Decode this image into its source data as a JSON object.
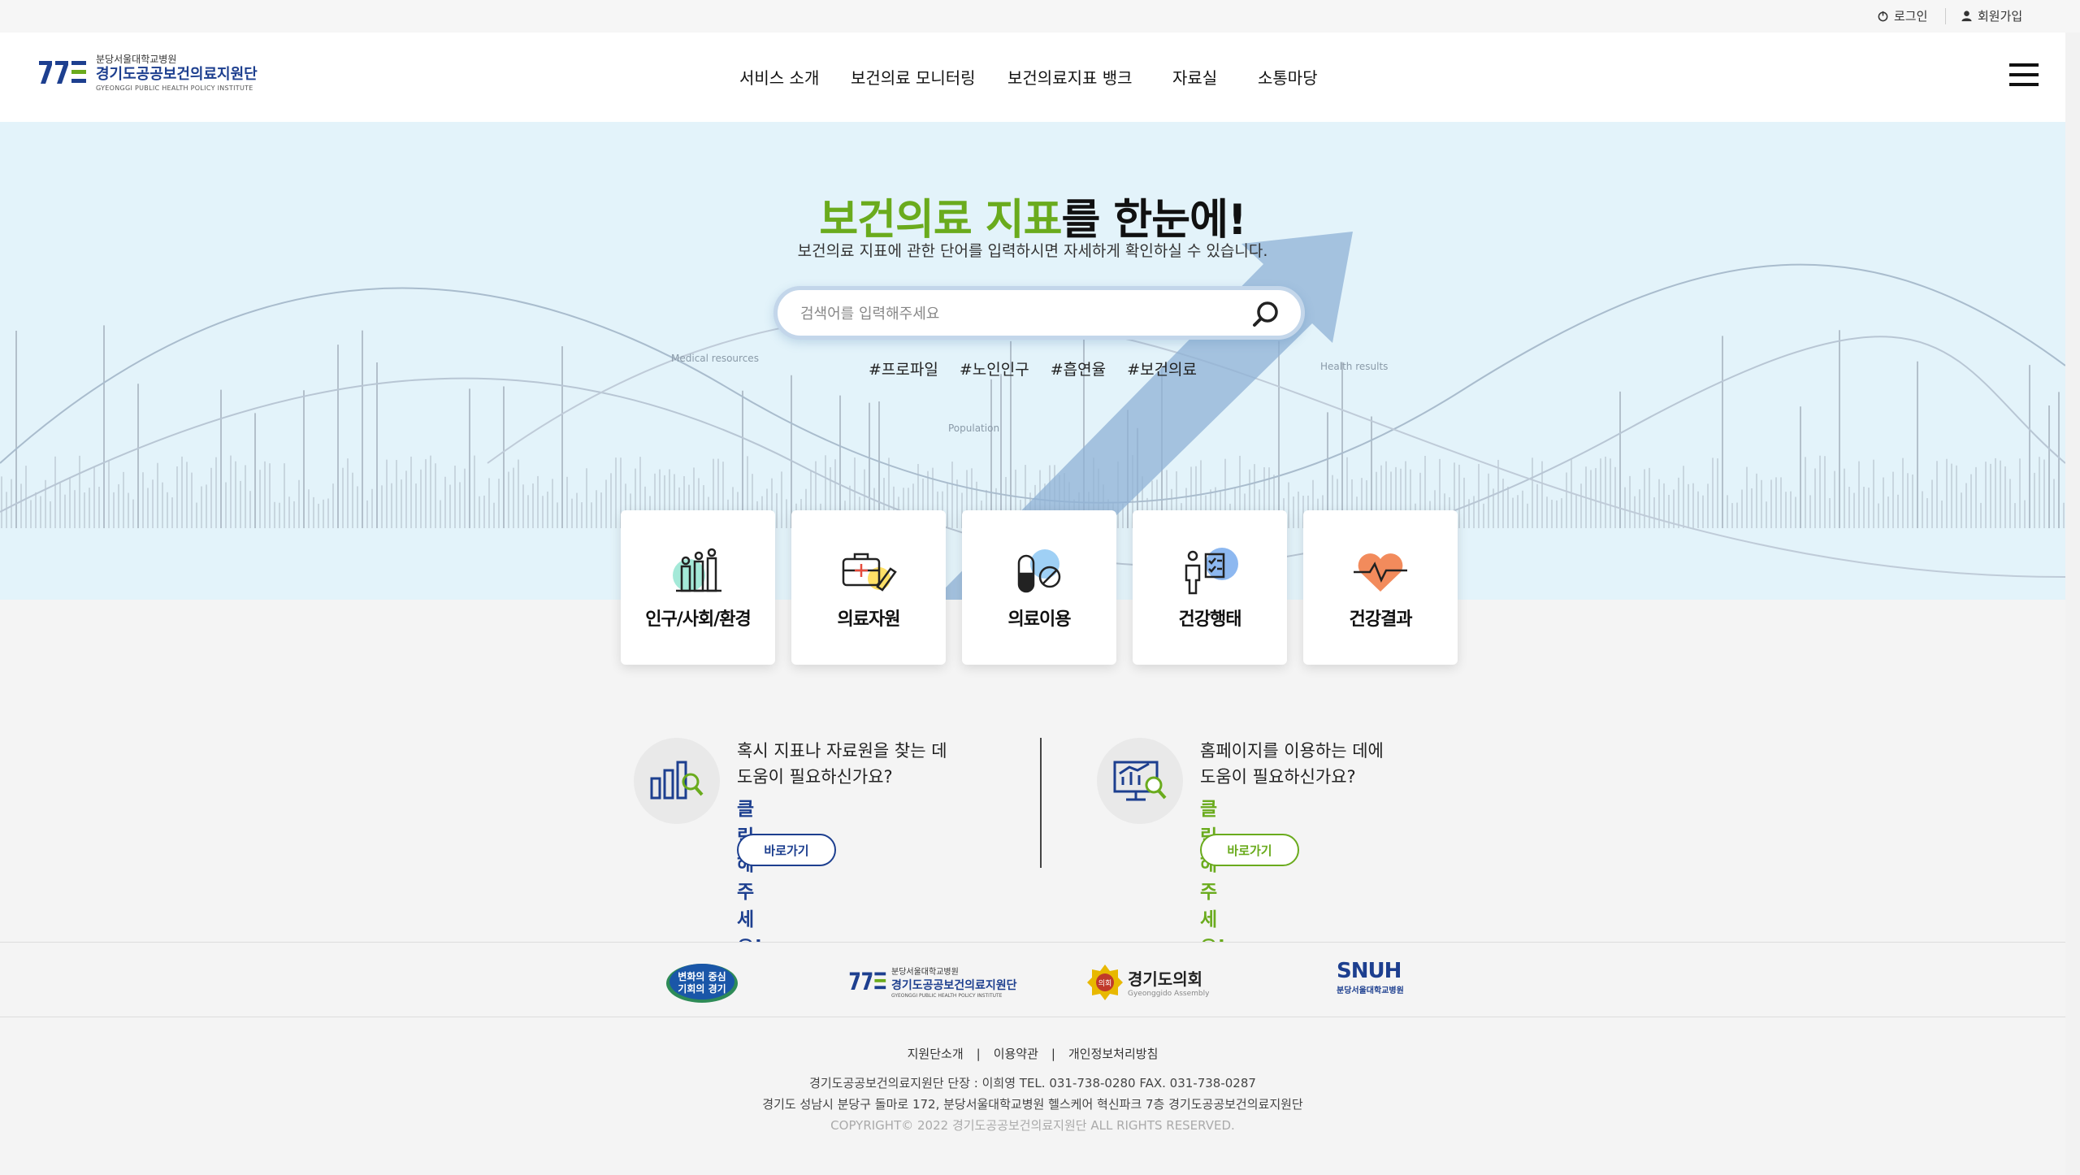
{
  "util": {
    "login": "로그인",
    "signup": "회원가입"
  },
  "header": {
    "logo_sub": "분당서울대학교병원",
    "logo_main": "경기도공공보건의료지원단",
    "logo_en": "GYEONGGI PUBLIC HEALTH POLICY INSTITUTE",
    "nav": [
      "서비스 소개",
      "보건의료 모니터링",
      "보건의료지표 뱅크",
      "자료실",
      "소통마당"
    ]
  },
  "hero": {
    "title_green": "보건의료 지표",
    "title_dark": "를 한눈에!",
    "description": "보건의료 지표에 관한 단어를 입력하시면 자세하게 확인하실 수 있습니다.",
    "search_placeholder": "검색어를 입력해주세요",
    "tags": [
      "#프로파일",
      "#노인인구",
      "#흡연율",
      "#보건의료"
    ],
    "chart_labels": [
      "Medical resources",
      "Population",
      "Health results"
    ]
  },
  "categories": [
    {
      "label": "인구/사회/환경",
      "icon": "population-icon"
    },
    {
      "label": "의료자원",
      "icon": "medical-kit-icon"
    },
    {
      "label": "의료이용",
      "icon": "pill-icon"
    },
    {
      "label": "건강행태",
      "icon": "checklist-person-icon"
    },
    {
      "label": "건강결과",
      "icon": "heart-pulse-icon"
    }
  ],
  "help": [
    {
      "line1": "혹시 지표나 자료원을 찾는 데",
      "line2": "도움이 필요하신가요?",
      "cta": "클릭해주세요!",
      "button": "바로가기",
      "accent": "#1d3f8f"
    },
    {
      "line1": "홈페이지를 이용하는 데에",
      "line2": "도움이 필요하신가요?",
      "cta": "클릭해주세요!",
      "button": "바로가기",
      "accent": "#6aab1d"
    }
  ],
  "partners": {
    "gyeonggi_line1": "변화의 중심",
    "gyeonggi_line2": "기회의 경기",
    "institute_sub": "분당서울대학교병원",
    "institute_main": "경기도공공보건의료지원단",
    "institute_en": "GYEONGGI PUBLIC HEALTH POLICY INSTITUTE",
    "council_main": "경기도의회",
    "council_en": "Gyeonggido Assembly",
    "council_seal": "의회",
    "snuh_main": "SNUH",
    "snuh_sub": "분당서울대학교병원"
  },
  "footer": {
    "links": [
      "지원단소개",
      "이용약관",
      "개인정보처리방침"
    ],
    "line1": "경기도공공보건의료지원단 단장 : 이희영 TEL. 031-738-0280 FAX. 031-738-0287",
    "line2": "경기도 성남시 분당구 돌마로 172, 분당서울대학교병원 헬스케어 혁신파크 7층 경기도공공보건의료지원단",
    "copyright": "COPYRIGHT© 2022 경기도공공보건의료지원단 ALL RIGHTS RESERVED."
  },
  "colors": {
    "brand_blue": "#1d3f8f",
    "brand_green": "#6aab1d",
    "hero_bg": "#e3f3fa"
  }
}
